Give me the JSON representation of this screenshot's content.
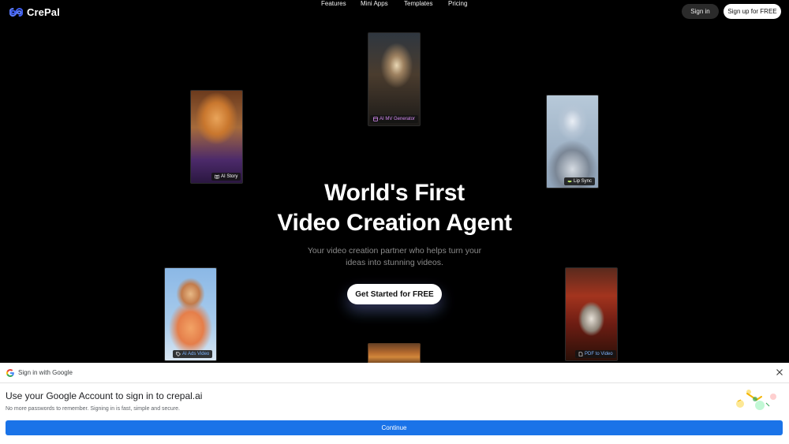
{
  "brand": {
    "name": "CrePal"
  },
  "nav": {
    "links": [
      "Features",
      "Mini Apps",
      "Templates",
      "Pricing"
    ],
    "signin": "Sign in",
    "signup": "Sign up for FREE"
  },
  "hero": {
    "headline_line1": "World's First",
    "headline_line2": "Video Creation Agent",
    "subtitle_line1": "Your video creation partner who helps turn your",
    "subtitle_line2": "ideas into stunning videos.",
    "cta": "Get Started for FREE"
  },
  "cards": {
    "story": "AI Story",
    "mv": "AI MV Generator",
    "lip": "Lip Sync",
    "ads": "AI Ads Video",
    "pdf": "PDF to Video"
  },
  "google": {
    "header": "Sign in with Google",
    "title": "Use your Google Account to sign in to crepal.ai",
    "subtitle": "No more passwords to remember. Signing in is fast, simple and secure.",
    "continue": "Continue"
  },
  "colors": {
    "background": "#000000",
    "google_blue": "#1a73e8",
    "mv_tag": "#d68bf2",
    "link_tag": "#7db5ff"
  }
}
